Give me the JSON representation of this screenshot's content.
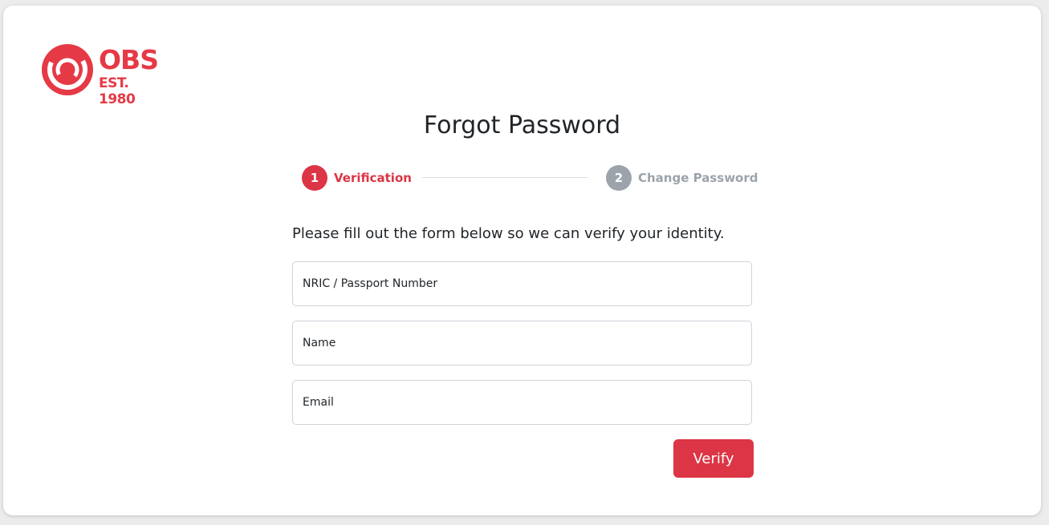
{
  "brand": {
    "name": "OBS",
    "tagline": "EST. 1980",
    "color": "#e63946"
  },
  "page": {
    "title": "Forgot Password",
    "instructions": "Please fill out the form below so we can verify your identity."
  },
  "stepper": {
    "steps": [
      {
        "number": "1",
        "label": "Verification",
        "state": "active",
        "color": "#dc3545"
      },
      {
        "number": "2",
        "label": "Change Password",
        "state": "inactive",
        "color": "#9ca3ab"
      }
    ]
  },
  "form": {
    "fields": [
      {
        "placeholder": "NRIC / Passport Number",
        "value": ""
      },
      {
        "placeholder": "Name",
        "value": ""
      },
      {
        "placeholder": "Email",
        "value": ""
      }
    ],
    "submit_label": "Verify",
    "submit_color": "#dc3545"
  }
}
